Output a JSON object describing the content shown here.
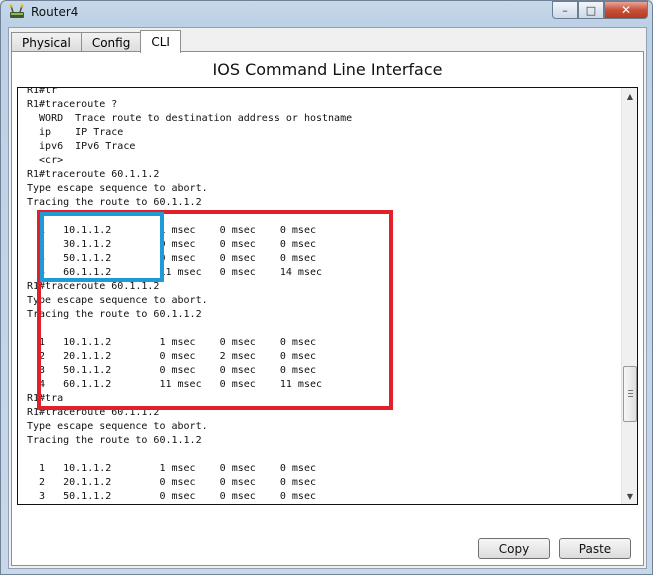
{
  "window": {
    "title": "Router4",
    "minimize_glyph": "–",
    "maximize_glyph": "□",
    "close_glyph": "✕",
    "icon": "router-app-icon"
  },
  "tabs": [
    {
      "label": "Physical",
      "active": false
    },
    {
      "label": "Config",
      "active": false
    },
    {
      "label": "CLI",
      "active": true
    }
  ],
  "panel": {
    "heading": "IOS Command Line Interface"
  },
  "console": {
    "lines": [
      "R1#tr",
      "R1#traceroute ?",
      "  WORD  Trace route to destination address or hostname",
      "  ip    IP Trace",
      "  ipv6  IPv6 Trace",
      "  <cr>",
      "R1#traceroute 60.1.1.2",
      "Type escape sequence to abort.",
      "Tracing the route to 60.1.1.2",
      "",
      "  1   10.1.1.2        1 msec    0 msec    0 msec",
      "  2   30.1.1.2        0 msec    0 msec    0 msec",
      "  3   50.1.1.2        0 msec    0 msec    0 msec",
      "  4   60.1.1.2        11 msec   0 msec    14 msec",
      "R1#traceroute 60.1.1.2",
      "Type escape sequence to abort.",
      "Tracing the route to 60.1.1.2",
      "",
      "  1   10.1.1.2        1 msec    0 msec    0 msec",
      "  2   20.1.1.2        0 msec    2 msec    0 msec",
      "  3   50.1.1.2        0 msec    0 msec    0 msec",
      "  4   60.1.1.2        11 msec   0 msec    11 msec",
      "R1#tra",
      "R1#traceroute 60.1.1.2",
      "Type escape sequence to abort.",
      "Tracing the route to 60.1.1.2",
      "",
      "  1   10.1.1.2        1 msec    0 msec    0 msec",
      "  2   20.1.1.2        0 msec    0 msec    0 msec",
      "  3   50.1.1.2        0 msec    0 msec    0 msec"
    ]
  },
  "buttons": {
    "copy": "Copy",
    "paste": "Paste"
  },
  "colors": {
    "highlight_red": "#e0212b",
    "highlight_blue": "#1e9ad6"
  }
}
